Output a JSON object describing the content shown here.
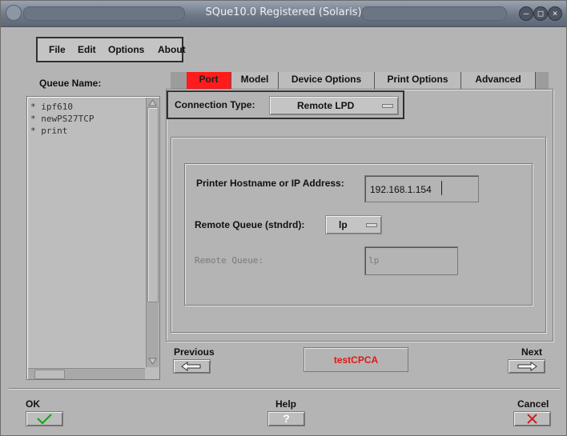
{
  "window": {
    "title": "SQue10.0 Registered (Solaris)"
  },
  "menu": [
    "File",
    "Edit",
    "Options",
    "About"
  ],
  "queue": {
    "label": "Queue Name:",
    "items": [
      "* ipf610",
      "* newPS27TCP",
      "* print"
    ]
  },
  "tabs": [
    "Port",
    "Model",
    "Device Options",
    "Print Options",
    "Advanced"
  ],
  "active_tab": "Port",
  "connection": {
    "label": "Connection Type:",
    "value": "Remote LPD"
  },
  "form": {
    "host_label": "Printer Hostname or IP Address:",
    "host_value": "192.168.1.154",
    "remote_std_label": "Remote Queue (stndrd):",
    "remote_std_value": "lp",
    "remote_label": "Remote Queue:",
    "remote_value": "lp"
  },
  "nav": {
    "previous": "Previous",
    "next": "Next",
    "status": "testCPCA"
  },
  "bottom": {
    "ok": "OK",
    "help": "Help",
    "cancel": "Cancel"
  },
  "colors": {
    "active_tab": "#ff1c1c",
    "status_text": "#e01818",
    "ok_check": "#1aa51a",
    "cancel_x": "#d02020"
  }
}
